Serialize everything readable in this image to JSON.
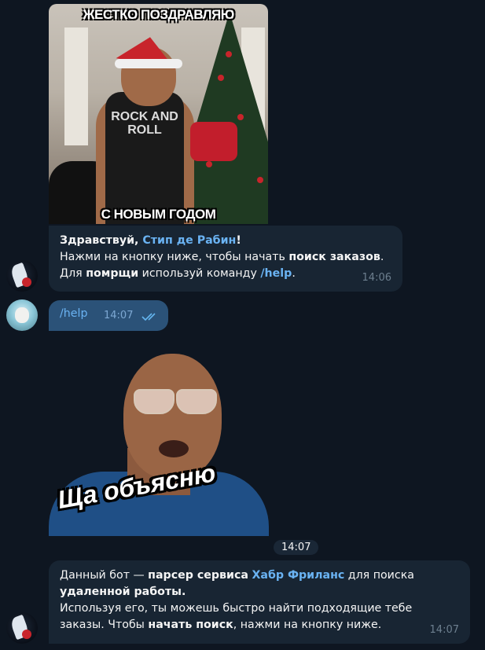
{
  "meme": {
    "caption_top": "ЖЕСТКО ПОЗДРАВЛЯЮ",
    "caption_bottom": "С НОВЫМ ГОДОМ",
    "shirt_text": "ROCK AND ROLL"
  },
  "msg1": {
    "greeting": "Здравствуй, ",
    "name": "Стип де Рабин",
    "excl": "!",
    "line2_a": "Нажми на кнопку ниже, чтобы начать ",
    "line2_b": "поиск заказов",
    "line2_c": ".",
    "line3_a": "Для ",
    "line3_b": "помрщи",
    "line3_c": " используй команду ",
    "line3_cmd": "/help",
    "line3_d": ".",
    "time": "14:06"
  },
  "msg_out": {
    "text": "/help",
    "time": "14:07",
    "status_icon": "double-check-icon"
  },
  "sticker": {
    "caption": "Ща объясню",
    "time": "14:07"
  },
  "msg2": {
    "p1_a": "Данный бот — ",
    "p1_b": "парсер сервиса",
    "p1_c": " ",
    "p1_link": "Хабр Фриланс",
    "p1_d": " для поиска",
    "p1_e": "удаленной работы.",
    "p2_a": "Используя его, ты можешь быстро найти подходящие тебе",
    "p2_b": "заказы. Чтобы ",
    "p2_c": "начать поиск",
    "p2_d": ", нажми на кнопку ниже.",
    "time": "14:07"
  },
  "colors": {
    "background": "#0e1621",
    "incoming_bubble": "#182533",
    "outgoing_bubble": "#2b5278",
    "link": "#6ab3f3"
  }
}
